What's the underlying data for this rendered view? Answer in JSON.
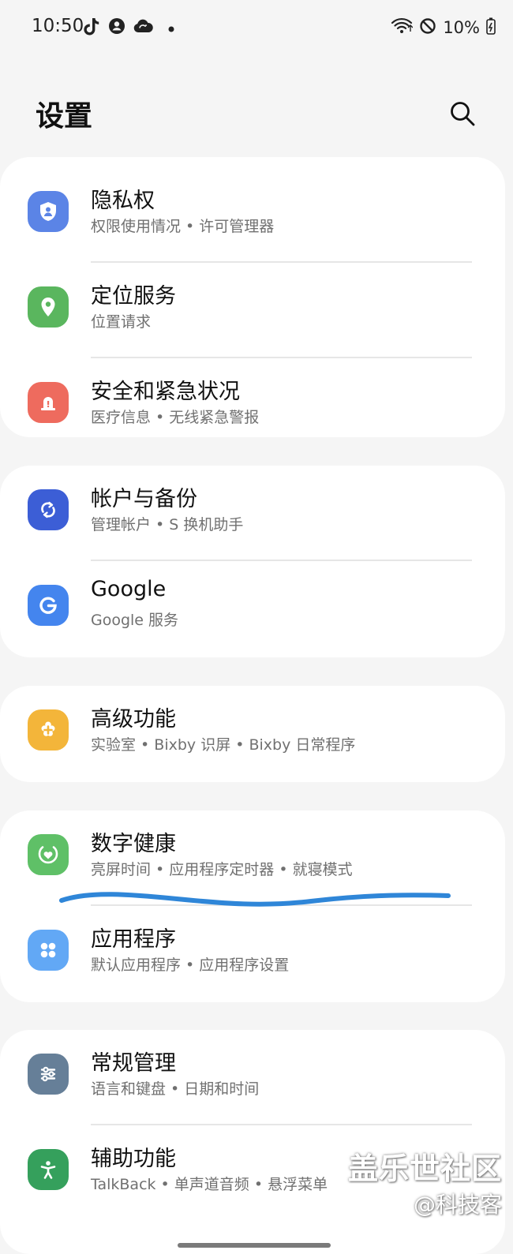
{
  "status_bar": {
    "time": "10:50",
    "left_icons": [
      "tiktok-icon",
      "account-icon",
      "cloud-sync-icon",
      "notification-dot-icon"
    ],
    "right_icons": [
      "wifi-icon",
      "do-not-disturb-icon",
      "battery-charging-icon"
    ],
    "battery_percent": "10%"
  },
  "header": {
    "title": "设置",
    "search_icon": "search-icon"
  },
  "groups": [
    {
      "items": [
        {
          "title": "隐私权",
          "subtitle": "权限使用情况 • 许可管理器",
          "icon": "privacy-shield-icon",
          "color": "#5b84e6"
        },
        {
          "title": "定位服务",
          "subtitle": "位置请求",
          "icon": "location-pin-icon",
          "color": "#5ab65e"
        },
        {
          "title": "安全和紧急状况",
          "subtitle": "医疗信息 • 无线紧急警报",
          "icon": "emergency-alert-icon",
          "color": "#ee6b5e"
        }
      ]
    },
    {
      "items": [
        {
          "title": "帐户与备份",
          "subtitle": "管理帐户 • S 换机助手",
          "icon": "sync-icon",
          "color": "#3c5ed6"
        },
        {
          "title": "Google",
          "subtitle": "Google 服务",
          "icon": "google-icon",
          "color": "#4485ee"
        }
      ]
    },
    {
      "items": [
        {
          "title": "高级功能",
          "subtitle": "实验室 • Bixby 识屏 • Bixby 日常程序",
          "icon": "advanced-features-icon",
          "color": "#f3b53a"
        }
      ]
    },
    {
      "items": [
        {
          "title": "数字健康",
          "subtitle": "亮屏时间 • 应用程序定时器 • 就寝模式",
          "icon": "digital-wellbeing-icon",
          "color": "#5fc067"
        },
        {
          "title": "应用程序",
          "subtitle": "默认应用程序 • 应用程序设置",
          "icon": "apps-grid-icon",
          "color": "#62a8f5"
        }
      ]
    },
    {
      "items": [
        {
          "title": "常规管理",
          "subtitle": "语言和键盘 • 日期和时间",
          "icon": "general-management-icon",
          "color": "#667f98"
        },
        {
          "title": "辅助功能",
          "subtitle": "TalkBack • 单声道音频 • 悬浮菜单",
          "icon": "accessibility-icon",
          "color": "#35a05c"
        }
      ]
    }
  ],
  "annotation_color": "#2f86d8",
  "watermark": {
    "line1": "盖乐世社区",
    "line2": "@科技客"
  }
}
